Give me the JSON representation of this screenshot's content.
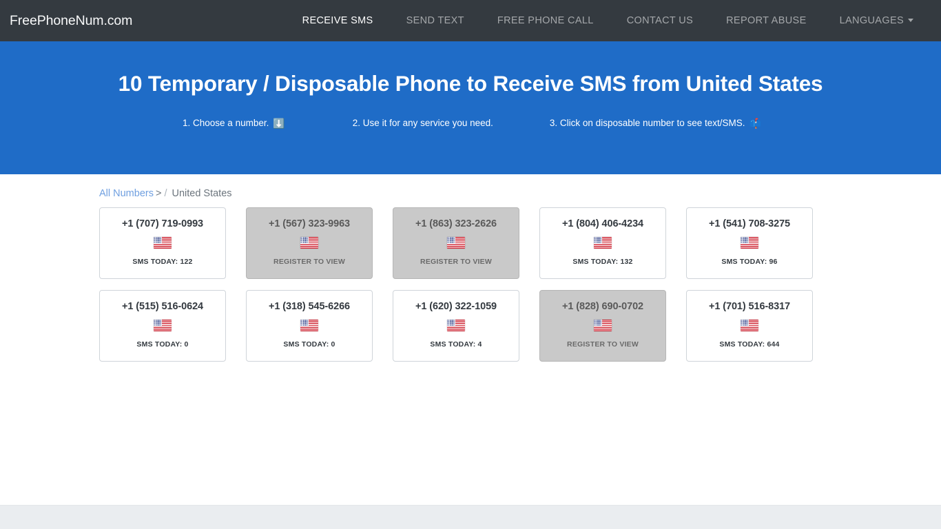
{
  "navbar": {
    "brand": "FreePhoneNum.com",
    "links": [
      {
        "label": "RECEIVE SMS",
        "active": true
      },
      {
        "label": "SEND TEXT",
        "active": false
      },
      {
        "label": "FREE PHONE CALL",
        "active": false
      },
      {
        "label": "CONTACT US",
        "active": false
      },
      {
        "label": "REPORT ABUSE",
        "active": false
      },
      {
        "label": "LANGUAGES",
        "active": false,
        "dropdown": true
      }
    ]
  },
  "hero": {
    "title": "10 Temporary / Disposable Phone to Receive SMS from United States",
    "steps": [
      {
        "text": "1. Choose a number.",
        "emoji": "⬇️",
        "icon_name": "down-arrow-icon"
      },
      {
        "text": "2. Use it for any service you need.",
        "emoji": "",
        "icon_name": ""
      },
      {
        "text": "3. Click on disposable number to see text/SMS.",
        "emoji": "📫",
        "icon_name": "mailbox-icon"
      }
    ]
  },
  "breadcrumb": {
    "root_label": "All Numbers",
    "gt": ">",
    "separator": "/",
    "current": "United States"
  },
  "numbers": [
    {
      "number": "+1 (707) 719-0993",
      "status": "SMS TODAY: 122",
      "locked": false,
      "flag": "us-flag-icon"
    },
    {
      "number": "+1 (567) 323-9963",
      "status": "REGISTER TO VIEW",
      "locked": true,
      "flag": "us-flag-icon"
    },
    {
      "number": "+1 (863) 323-2626",
      "status": "REGISTER TO VIEW",
      "locked": true,
      "flag": "us-flag-icon"
    },
    {
      "number": "+1 (804) 406-4234",
      "status": "SMS TODAY: 132",
      "locked": false,
      "flag": "us-flag-icon"
    },
    {
      "number": "+1 (541) 708-3275",
      "status": "SMS TODAY: 96",
      "locked": false,
      "flag": "us-flag-icon"
    },
    {
      "number": "+1 (515) 516-0624",
      "status": "SMS TODAY: 0",
      "locked": false,
      "flag": "us-flag-icon"
    },
    {
      "number": "+1 (318) 545-6266",
      "status": "SMS TODAY: 0",
      "locked": false,
      "flag": "us-flag-icon"
    },
    {
      "number": "+1 (620) 322-1059",
      "status": "SMS TODAY: 4",
      "locked": false,
      "flag": "us-flag-icon"
    },
    {
      "number": "+1 (828) 690-0702",
      "status": "REGISTER TO VIEW",
      "locked": true,
      "flag": "us-flag-icon"
    },
    {
      "number": "+1 (701) 516-8317",
      "status": "SMS TODAY: 644",
      "locked": false,
      "flag": "us-flag-icon"
    }
  ],
  "colors": {
    "navbar_bg": "#343a40",
    "hero_bg": "#1f6cc7",
    "link_blue": "#6f9fe0",
    "card_locked_bg": "#c9c9c9",
    "footer_bg": "#eaedf0"
  }
}
